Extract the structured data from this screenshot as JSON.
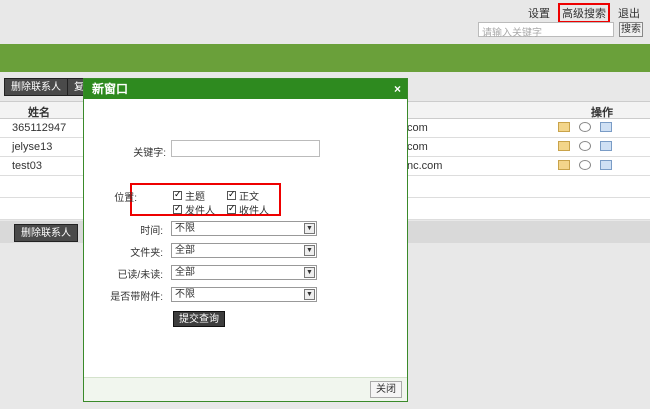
{
  "toplinks": {
    "settings": "设置",
    "advanced_search": "高级搜索",
    "logout": "退出"
  },
  "search": {
    "placeholder": "请输入关键字",
    "button": "搜索"
  },
  "toolbar": {
    "delete_contact": "删除联系人",
    "copy_partial": "复"
  },
  "table": {
    "col_name": "姓名",
    "col_ops": "操作",
    "rows": [
      {
        "name": "365112947",
        "email_tail": "com"
      },
      {
        "name": "jelyse13",
        "email_tail": "com"
      },
      {
        "name": "test03",
        "email_tail": "nc.com"
      }
    ]
  },
  "bottom_toolbar": {
    "delete_contact": "删除联系人"
  },
  "dialog": {
    "title": "新窗口",
    "close_icon": "×",
    "keyword_label": "关键字:",
    "position_label": "位置:",
    "position_options": [
      "主题",
      "正文",
      "发件人",
      "收件人"
    ],
    "time_label": "时间:",
    "time_value": "不限",
    "folder_label": "文件夹:",
    "folder_value": "全部",
    "read_label": "已读/未读:",
    "read_value": "全部",
    "attach_label": "是否带附件:",
    "attach_value": "不限",
    "submit": "提交查询",
    "close": "关闭"
  },
  "colors": {
    "brand_green": "#6aa03a",
    "dialog_header": "#2e8a1f",
    "highlight": "#e00000"
  }
}
